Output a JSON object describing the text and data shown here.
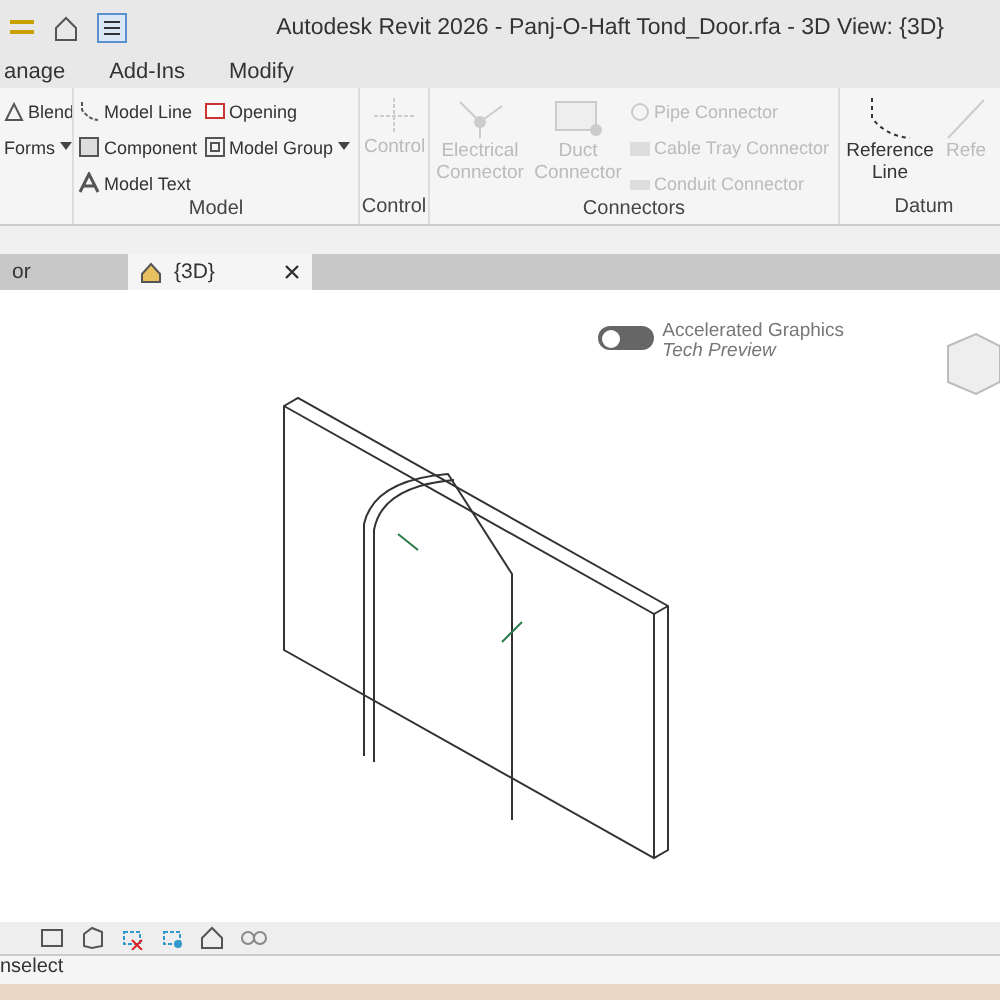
{
  "window": {
    "title": "Autodesk Revit 2026 - Panj-O-Haft Tond_Door.rfa - 3D View: {3D}"
  },
  "ribbon_tabs": [
    {
      "label": "anage",
      "selected": false
    },
    {
      "label": "Add-Ins",
      "selected": false
    },
    {
      "label": "Modify",
      "selected": false
    }
  ],
  "panels": [
    {
      "items": [
        {
          "label": "Blend",
          "disabled": false,
          "kind": "small"
        },
        {
          "label": "Forms",
          "disabled": false,
          "kind": "dropdown"
        }
      ]
    },
    {
      "title": "Model",
      "items": [
        {
          "label": "Model Line",
          "disabled": false,
          "kind": "small"
        },
        {
          "label": "Component",
          "disabled": false,
          "kind": "small"
        },
        {
          "label": "Model Text",
          "disabled": false,
          "kind": "small"
        },
        {
          "label": "Opening",
          "disabled": false,
          "kind": "small"
        },
        {
          "label": "Model Group",
          "disabled": false,
          "kind": "dropdown"
        }
      ]
    },
    {
      "title": "Control",
      "items": [
        {
          "label": "Control",
          "disabled": true,
          "kind": "large"
        }
      ]
    },
    {
      "title": "Connectors",
      "items": [
        {
          "label": "Electrical Connector",
          "disabled": true,
          "kind": "large"
        },
        {
          "label": "Duct Connector",
          "disabled": true,
          "kind": "large"
        },
        {
          "label": "Pipe Connector",
          "disabled": true,
          "kind": "small"
        },
        {
          "label": "Cable Tray Connector",
          "disabled": true,
          "kind": "small"
        },
        {
          "label": "Conduit Connector",
          "disabled": true,
          "kind": "small"
        }
      ]
    },
    {
      "title": "Datum",
      "items": [
        {
          "label": "Reference Line",
          "disabled": false,
          "kind": "large"
        },
        {
          "label": "Refe",
          "disabled": true,
          "kind": "large"
        }
      ]
    }
  ],
  "view_tabs": [
    {
      "label": "or",
      "selected": false,
      "closable": false
    },
    {
      "label": "{3D}",
      "selected": true,
      "closable": true
    }
  ],
  "graphics_toggle": {
    "on": false,
    "title": "Accelerated Graphics",
    "subtitle": "Tech Preview"
  },
  "status_bar": {
    "text": "nselect"
  }
}
